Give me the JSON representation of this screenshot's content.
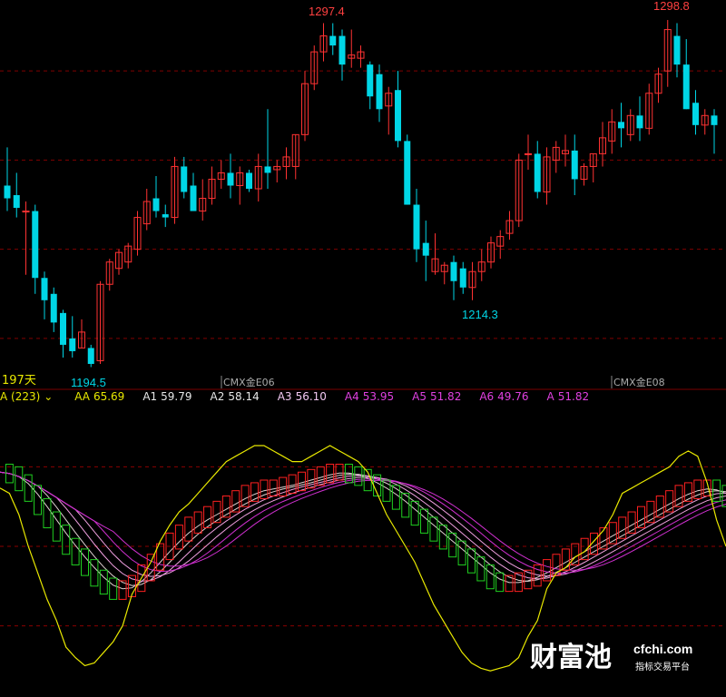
{
  "chart_data": {
    "type": "candlestick",
    "price_labels": {
      "high_left": "1297.4",
      "high_right": "1298.8",
      "low_left": "1194.5",
      "low_mid": "1214.3"
    },
    "days_label": "197天",
    "contract_markers": [
      "CMX金E06",
      "CMX金E08"
    ],
    "price_range": [
      1188,
      1302
    ],
    "candles": [
      {
        "o": 1246,
        "h": 1258,
        "l": 1238,
        "c": 1242
      },
      {
        "o": 1243,
        "h": 1250,
        "l": 1236,
        "c": 1239
      },
      {
        "o": 1238,
        "h": 1241,
        "l": 1218,
        "c": 1238
      },
      {
        "o": 1238,
        "h": 1240,
        "l": 1212,
        "c": 1217
      },
      {
        "o": 1217,
        "h": 1219,
        "l": 1204,
        "c": 1210
      },
      {
        "o": 1212,
        "h": 1214,
        "l": 1200,
        "c": 1203
      },
      {
        "o": 1206,
        "h": 1207,
        "l": 1192,
        "c": 1196
      },
      {
        "o": 1198,
        "h": 1205,
        "l": 1192,
        "c": 1194
      },
      {
        "o": 1195,
        "h": 1204,
        "l": 1195,
        "c": 1200
      },
      {
        "o": 1195,
        "h": 1196,
        "l": 1189,
        "c": 1190
      },
      {
        "o": 1191,
        "h": 1216,
        "l": 1190,
        "c": 1215
      },
      {
        "o": 1215,
        "h": 1223,
        "l": 1213,
        "c": 1222
      },
      {
        "o": 1220,
        "h": 1226,
        "l": 1218,
        "c": 1225
      },
      {
        "o": 1222,
        "h": 1228,
        "l": 1220,
        "c": 1227
      },
      {
        "o": 1226,
        "h": 1238,
        "l": 1224,
        "c": 1236
      },
      {
        "o": 1234,
        "h": 1245,
        "l": 1232,
        "c": 1241
      },
      {
        "o": 1242,
        "h": 1249,
        "l": 1236,
        "c": 1238
      },
      {
        "o": 1237,
        "h": 1240,
        "l": 1233,
        "c": 1236
      },
      {
        "o": 1236,
        "h": 1255,
        "l": 1234,
        "c": 1252
      },
      {
        "o": 1252,
        "h": 1255,
        "l": 1242,
        "c": 1244
      },
      {
        "o": 1246,
        "h": 1250,
        "l": 1238,
        "c": 1238
      },
      {
        "o": 1238,
        "h": 1248,
        "l": 1235,
        "c": 1242
      },
      {
        "o": 1242,
        "h": 1252,
        "l": 1240,
        "c": 1248
      },
      {
        "o": 1248,
        "h": 1254,
        "l": 1245,
        "c": 1250
      },
      {
        "o": 1250,
        "h": 1256,
        "l": 1242,
        "c": 1246
      },
      {
        "o": 1246,
        "h": 1252,
        "l": 1240,
        "c": 1250
      },
      {
        "o": 1250,
        "h": 1251,
        "l": 1244,
        "c": 1245
      },
      {
        "o": 1245,
        "h": 1256,
        "l": 1241,
        "c": 1252
      },
      {
        "o": 1252,
        "h": 1270,
        "l": 1245,
        "c": 1250
      },
      {
        "o": 1251,
        "h": 1254,
        "l": 1247,
        "c": 1252
      },
      {
        "o": 1252,
        "h": 1258,
        "l": 1248,
        "c": 1255
      },
      {
        "o": 1252,
        "h": 1262,
        "l": 1248,
        "c": 1262
      },
      {
        "o": 1262,
        "h": 1282,
        "l": 1260,
        "c": 1278
      },
      {
        "o": 1278,
        "h": 1290,
        "l": 1276,
        "c": 1288
      },
      {
        "o": 1288,
        "h": 1297,
        "l": 1285,
        "c": 1293
      },
      {
        "o": 1293,
        "h": 1297,
        "l": 1287,
        "c": 1290
      },
      {
        "o": 1293,
        "h": 1295,
        "l": 1279,
        "c": 1284
      },
      {
        "o": 1286,
        "h": 1295,
        "l": 1283,
        "c": 1287
      },
      {
        "o": 1286,
        "h": 1290,
        "l": 1283,
        "c": 1288
      },
      {
        "o": 1284,
        "h": 1285,
        "l": 1270,
        "c": 1274
      },
      {
        "o": 1281,
        "h": 1284,
        "l": 1266,
        "c": 1270
      },
      {
        "o": 1271,
        "h": 1277,
        "l": 1262,
        "c": 1275
      },
      {
        "o": 1276,
        "h": 1282,
        "l": 1258,
        "c": 1260
      },
      {
        "o": 1260,
        "h": 1262,
        "l": 1240,
        "c": 1240
      },
      {
        "o": 1240,
        "h": 1245,
        "l": 1222,
        "c": 1226
      },
      {
        "o": 1228,
        "h": 1235,
        "l": 1216,
        "c": 1224
      },
      {
        "o": 1219,
        "h": 1231,
        "l": 1218,
        "c": 1223
      },
      {
        "o": 1219,
        "h": 1222,
        "l": 1215,
        "c": 1221
      },
      {
        "o": 1222,
        "h": 1224,
        "l": 1210,
        "c": 1216
      },
      {
        "o": 1220,
        "h": 1222,
        "l": 1212,
        "c": 1214
      },
      {
        "o": 1214,
        "h": 1222,
        "l": 1210,
        "c": 1219
      },
      {
        "o": 1219,
        "h": 1226,
        "l": 1216,
        "c": 1222
      },
      {
        "o": 1222,
        "h": 1230,
        "l": 1220,
        "c": 1228
      },
      {
        "o": 1227,
        "h": 1232,
        "l": 1223,
        "c": 1230
      },
      {
        "o": 1231,
        "h": 1238,
        "l": 1229,
        "c": 1235
      },
      {
        "o": 1235,
        "h": 1256,
        "l": 1233,
        "c": 1254
      },
      {
        "o": 1256,
        "h": 1262,
        "l": 1251,
        "c": 1256
      },
      {
        "o": 1256,
        "h": 1260,
        "l": 1242,
        "c": 1244
      },
      {
        "o": 1244,
        "h": 1258,
        "l": 1240,
        "c": 1255
      },
      {
        "o": 1254,
        "h": 1260,
        "l": 1250,
        "c": 1258
      },
      {
        "o": 1256,
        "h": 1262,
        "l": 1252,
        "c": 1257
      },
      {
        "o": 1257,
        "h": 1262,
        "l": 1243,
        "c": 1248
      },
      {
        "o": 1248,
        "h": 1253,
        "l": 1246,
        "c": 1252
      },
      {
        "o": 1252,
        "h": 1256,
        "l": 1247,
        "c": 1256
      },
      {
        "o": 1256,
        "h": 1266,
        "l": 1252,
        "c": 1261
      },
      {
        "o": 1260,
        "h": 1270,
        "l": 1256,
        "c": 1266
      },
      {
        "o": 1266,
        "h": 1272,
        "l": 1258,
        "c": 1264
      },
      {
        "o": 1262,
        "h": 1270,
        "l": 1260,
        "c": 1268
      },
      {
        "o": 1268,
        "h": 1274,
        "l": 1260,
        "c": 1264
      },
      {
        "o": 1264,
        "h": 1278,
        "l": 1262,
        "c": 1275
      },
      {
        "o": 1275,
        "h": 1283,
        "l": 1272,
        "c": 1281
      },
      {
        "o": 1282,
        "h": 1298,
        "l": 1277,
        "c": 1295
      },
      {
        "o": 1293,
        "h": 1297,
        "l": 1280,
        "c": 1284
      },
      {
        "o": 1284,
        "h": 1292,
        "l": 1270,
        "c": 1270
      },
      {
        "o": 1272,
        "h": 1276,
        "l": 1262,
        "c": 1265
      },
      {
        "o": 1265,
        "h": 1270,
        "l": 1262,
        "c": 1268
      },
      {
        "o": 1268,
        "h": 1270,
        "l": 1256,
        "c": 1265
      }
    ],
    "indicator": {
      "title": "A (223)",
      "dropdown_glyph": "⌄",
      "values": [
        {
          "name": "AA",
          "value": "65.69",
          "color": "#e8e800"
        },
        {
          "name": "A1",
          "value": "59.79",
          "color": "#e6e6e6"
        },
        {
          "name": "A2",
          "value": "58.14",
          "color": "#e6e6e6"
        },
        {
          "name": "A3",
          "value": "56.10",
          "color": "#f2c8f2"
        },
        {
          "name": "A4",
          "value": "53.95",
          "color": "#e040e0"
        },
        {
          "name": "A5",
          "value": "51.82",
          "color": "#e040e0"
        },
        {
          "name": "A6",
          "value": "49.76",
          "color": "#e040e0"
        },
        {
          "name": "A",
          "value": "51.82",
          "color": "#e040e0"
        }
      ],
      "range": [
        0,
        100
      ],
      "aa_line": [
        72,
        70,
        62,
        50,
        40,
        30,
        22,
        12,
        8,
        5,
        6,
        10,
        14,
        20,
        32,
        38,
        44,
        52,
        58,
        63,
        66,
        70,
        74,
        78,
        82,
        84,
        86,
        88,
        88,
        86,
        84,
        82,
        82,
        84,
        86,
        88,
        86,
        84,
        82,
        78,
        70,
        62,
        56,
        50,
        44,
        36,
        28,
        22,
        16,
        10,
        6,
        4,
        3,
        4,
        5,
        8,
        16,
        22,
        34,
        40,
        42,
        46,
        48,
        52,
        56,
        62,
        70,
        72,
        74,
        76,
        78,
        80,
        84,
        86,
        84,
        74,
        60,
        50
      ],
      "a_line": [
        78,
        77,
        74,
        70,
        65,
        60,
        55,
        50,
        46,
        42,
        38,
        35,
        33,
        34,
        36,
        40,
        44,
        48,
        52,
        55,
        58,
        60,
        62,
        64,
        66,
        68,
        70,
        71,
        72,
        72,
        73,
        74,
        75,
        76,
        77,
        78,
        78,
        77,
        76,
        74,
        72,
        70,
        67,
        64,
        61,
        58,
        55,
        52,
        49,
        46,
        43,
        40,
        37,
        36,
        36,
        37,
        38,
        40,
        42,
        44,
        46,
        48,
        50,
        52,
        54,
        56,
        58,
        60,
        62,
        64,
        66,
        68,
        70,
        71,
        72,
        72,
        70,
        68
      ],
      "a_line_prev_offset": 0.5,
      "colors": {
        "up": "#ff2020",
        "down": "#20d020",
        "aa": "#e8e800",
        "ma_light": "#e0d0d0",
        "ma_pink": "#f0a0e0",
        "ma_magenta": "#d030d0",
        "grid": "#8b0000"
      }
    },
    "colors": {
      "up": "#ff3232",
      "down": "#00d6e6",
      "label_up": "#ff4040",
      "label_down": "#00d6e6",
      "label_days": "#e8e800",
      "grid": "#800000",
      "separator": "#7a0000"
    }
  },
  "watermark": {
    "brand": "财富池",
    "domain": "cfchi.com",
    "tagline": "指标交易平台"
  }
}
